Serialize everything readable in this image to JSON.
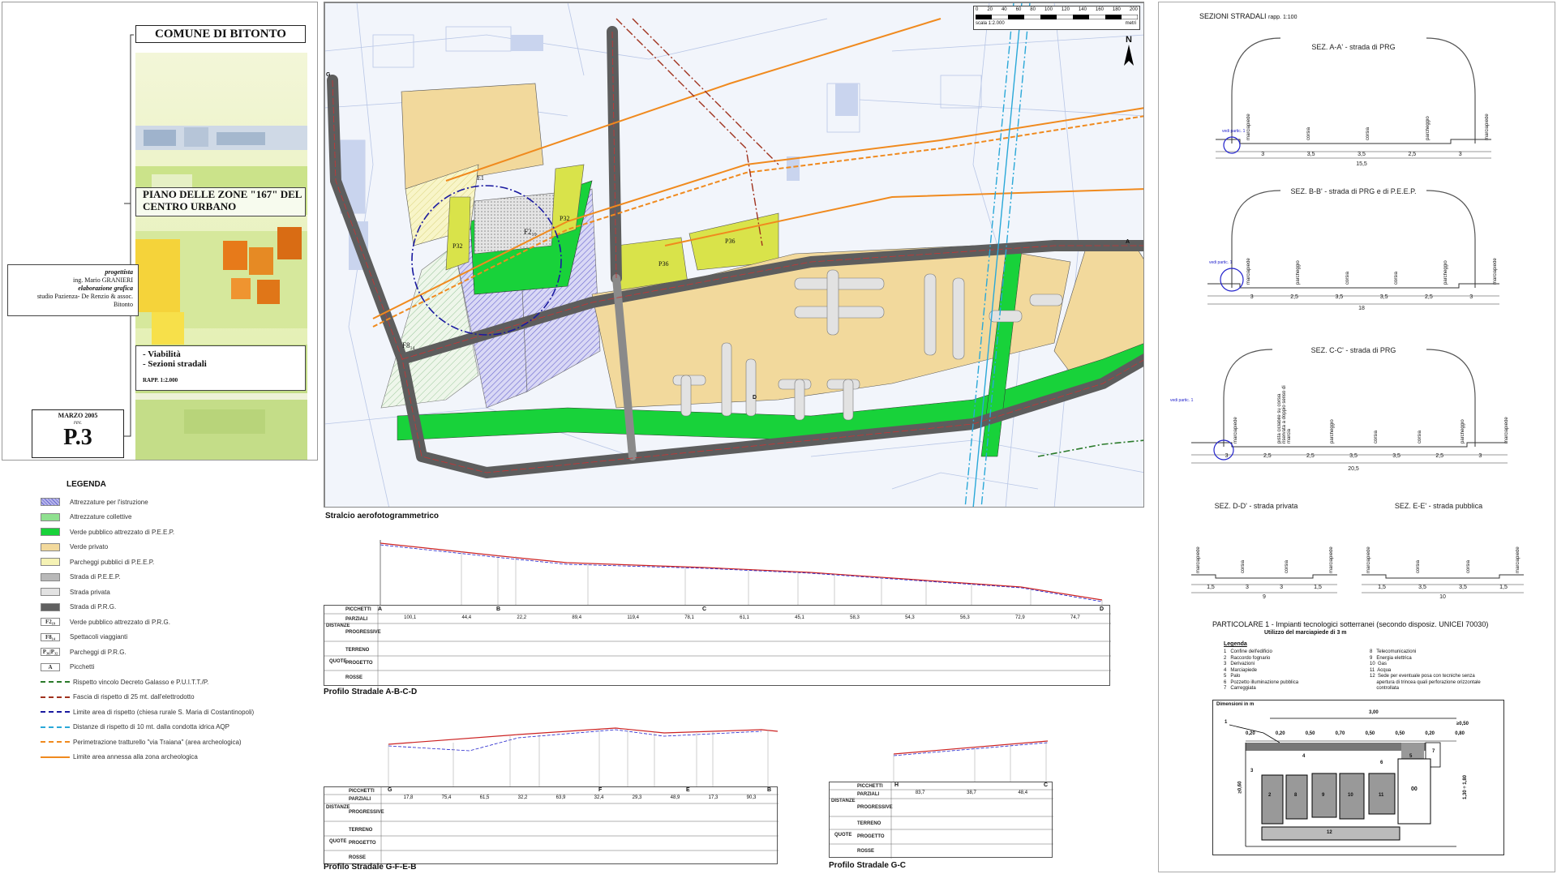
{
  "title_block": {
    "municipality": "COMUNE DI BITONTO",
    "plan_title": "PIANO DELLE ZONE \"167\" DEL CENTRO URBANO",
    "designer_label": "progettista",
    "designer_name": "ing. Mario GRANIERI",
    "graphics_label": "elaborazione grafica",
    "graphics_studio": "studio Pazienza- De Renzio & assoc.",
    "graphics_city": "Bitonto",
    "content_1": "- Viabilità",
    "content_2": "- Sezioni stradali",
    "scale": "RAPP. 1:2.000",
    "date": "MARZO 2005",
    "revision": "rev.",
    "sheet": "P.3"
  },
  "legend": {
    "heading": "LEGENDA",
    "items": [
      {
        "label": "Attrezzature per l'istruzione",
        "color": "#b7b6ea",
        "kind": "hatch"
      },
      {
        "label": "Attrezzature collettive",
        "color": "#8fe08f",
        "kind": "fill"
      },
      {
        "label": "Verde pubblico attrezzato di P.E.E.P.",
        "color": "#18d23a",
        "kind": "fill"
      },
      {
        "label": "Verde privato",
        "color": "#f2d99c",
        "kind": "fill"
      },
      {
        "label": "Parcheggi pubblici di P.E.E.P.",
        "color": "#f5f2b4",
        "kind": "fill"
      },
      {
        "label": "Strada di P.E.E.P.",
        "color": "#b8b8b8",
        "kind": "fill"
      },
      {
        "label": "Strada privata",
        "color": "#e2e2e2",
        "kind": "fill"
      },
      {
        "label": "Strada di P.R.G.",
        "color": "#606060",
        "kind": "fill"
      },
      {
        "label": "Verde pubblico attrezzato di P.R.G.",
        "tag": "F2₁₉",
        "kind": "tag"
      },
      {
        "label": "Spettacoli viaggianti",
        "tag": "F8₁₄",
        "kind": "tag"
      },
      {
        "label": "Parcheggi di P.R.G.",
        "tag": "P₃₆|P₃₂",
        "kind": "tag"
      },
      {
        "label": "Picchetti",
        "tag": "A",
        "kind": "tag"
      },
      {
        "label": "Rispetto vincolo Decreto Galasso e P.U.I.T.T./P.",
        "color": "#2a7a2a",
        "kind": "dashdot"
      },
      {
        "label": "Fascia di rispetto di 25 mt. dall'elettrodotto",
        "color": "#a0321e",
        "kind": "dashdot"
      },
      {
        "label": "Limite area di rispetto (chiesa rurale S. Maria di Costantinopoli)",
        "color": "#1a1aa0",
        "kind": "dashdot"
      },
      {
        "label": "Distanze di rispetto di 10 mt. dalla condotta idrica AQP",
        "color": "#2aa8d8",
        "kind": "dashdot"
      },
      {
        "label": "Perimetrazione tratturello \"via Traiana\" (area archeologica)",
        "color": "#f08a1e",
        "kind": "dashed"
      },
      {
        "label": "Limite area annessa alla zona archeologica",
        "color": "#f08a1e",
        "kind": "solid"
      }
    ]
  },
  "map": {
    "caption": "Stralcio aerofotogrammetrico",
    "scale_label": "scala 1:2.000",
    "scale_unit": "metri",
    "scale_ticks": [
      "0",
      "20",
      "40",
      "60",
      "80",
      "100",
      "120",
      "140",
      "160",
      "180",
      "200"
    ],
    "north": "N",
    "zones": [
      "F2₁₉",
      "P32",
      "P32",
      "P36",
      "P36",
      "F8₁₄",
      "E1"
    ],
    "stakes": [
      "A",
      "B",
      "C",
      "D",
      "E",
      "F",
      "G",
      "H"
    ]
  },
  "profile_abcd": {
    "caption": "Profilo Stradale A-B-C-D",
    "row_headers": [
      "PICCHETTI",
      "PARZIALI",
      "PROGRESSIVE",
      "TERRENO",
      "PROGETTO",
      "ROSSE"
    ],
    "group_labels": [
      "DISTANZE",
      "QUOTE"
    ],
    "partials": [
      "100,1",
      "44,4",
      "22,2",
      "89,4",
      "119,4",
      "78,1",
      "61,1",
      "45,1",
      "58,3",
      "54,3",
      "56,3",
      "72,9",
      "74,7"
    ],
    "stakes": [
      "A",
      "B",
      "C",
      "D"
    ]
  },
  "profile_gfeb": {
    "caption": "Profilo Stradale G-F-E-B",
    "row_headers": [
      "PICCHETTI",
      "PARZIALI",
      "PROGRESSIVE",
      "TERRENO",
      "PROGETTO",
      "ROSSE"
    ],
    "group_labels": [
      "DISTANZE",
      "QUOTE"
    ],
    "partials": [
      "17,8",
      "75,4",
      "61,5",
      "32,2",
      "63,9",
      "32,4",
      "29,3",
      "48,9",
      "17,3",
      "90,3"
    ],
    "stakes": [
      "G",
      "F",
      "E",
      "B"
    ]
  },
  "profile_gc": {
    "caption": "Profilo Stradale G-C",
    "row_headers": [
      "PICCHETTI",
      "PARZIALI",
      "PROGRESSIVE",
      "TERRENO",
      "PROGETTO",
      "ROSSE"
    ],
    "group_labels": [
      "DISTANZE",
      "QUOTE"
    ],
    "partials": [
      "83,7",
      "38,7",
      "48,4"
    ],
    "stakes": [
      "H",
      "C"
    ]
  },
  "sections": {
    "heading": "SEZIONI STRADALI",
    "heading_ratio": "rapp. 1:100",
    "aa": {
      "title": "SEZ. A-A' - strada di PRG",
      "labels": [
        "marciapiede",
        "corsia",
        "corsia",
        "parcheggio",
        "marciapiede"
      ],
      "dims": [
        "3",
        "3,5",
        "3,5",
        "2,5",
        "3"
      ],
      "total": "15,5",
      "note": "vedi partic. 1"
    },
    "bb": {
      "title": "SEZ. B-B' - strada di PRG e di P.E.E.P.",
      "labels": [
        "marciapiede",
        "parcheggio",
        "corsia",
        "corsia",
        "parcheggio",
        "marciapiede"
      ],
      "dims": [
        "3",
        "2,5",
        "3,5",
        "3,5",
        "2,5",
        "3"
      ],
      "total": "18",
      "note": "vedi partic. 1"
    },
    "cc": {
      "title": "SEZ. C-C' - strada di PRG",
      "labels": [
        "marciapiede",
        "pista ciclabile su corsia riservata a doppio senso di marcia",
        "parcheggio",
        "corsia",
        "corsia",
        "parcheggio",
        "marciapiede"
      ],
      "dims": [
        "3",
        "2,5",
        "2,5",
        "3,5",
        "3,5",
        "2,5",
        "3"
      ],
      "total": "20,5",
      "note": "vedi partic. 1"
    },
    "dd": {
      "title": "SEZ. D-D' - strada privata",
      "labels": [
        "marciapiede",
        "corsia",
        "corsia",
        "marciapiede"
      ],
      "dims": [
        "1,5",
        "3",
        "3",
        "1,5"
      ],
      "total": "9"
    },
    "ee": {
      "title": "SEZ. E-E' - strada pubblica",
      "labels": [
        "marciapiede",
        "corsia",
        "corsia",
        "marciapiede"
      ],
      "dims": [
        "1,5",
        "3,5",
        "3,5",
        "1,5"
      ],
      "total": "10"
    }
  },
  "particolare": {
    "title": "PARTICOLARE 1 - Impianti tecnologici sotterranei (secondo disposiz. UNICEI 70030)",
    "subtitle": "Utilizzo del marciapiede di 3 m",
    "legend_heading": "Legenda",
    "legend_left": [
      "1   Confine dell'edificio",
      "2   Raccordo fognario",
      "3   Derivazioni",
      "4   Marciapiede",
      "5   Palo",
      "6   Pozzetto illuminazione pubblica",
      "7   Carreggiata"
    ],
    "legend_right": [
      "8   Telecomunicazioni",
      "9   Energia elettrica",
      "10  Gas",
      "11  Acqua",
      "12  Sede per eventuale posa con tecniche senza",
      "     apertura di trincea quali perforazione orizzontale",
      "     controllata"
    ],
    "dims_caption": "Dimensioni in m",
    "dim_top": "3,00",
    "dims_row": [
      "0,20",
      "0,20",
      "0,50",
      "0,70",
      "0,50",
      "0,50",
      "0,20",
      "0,80"
    ],
    "dim_right": "≥0,50",
    "dim_left": "≥0,60",
    "dim_depth": "1,30 ÷ 1,80",
    "numbers": [
      "1",
      "2",
      "3",
      "4",
      "5",
      "6",
      "7",
      "8",
      "9",
      "10",
      "11",
      "12",
      "00"
    ]
  }
}
